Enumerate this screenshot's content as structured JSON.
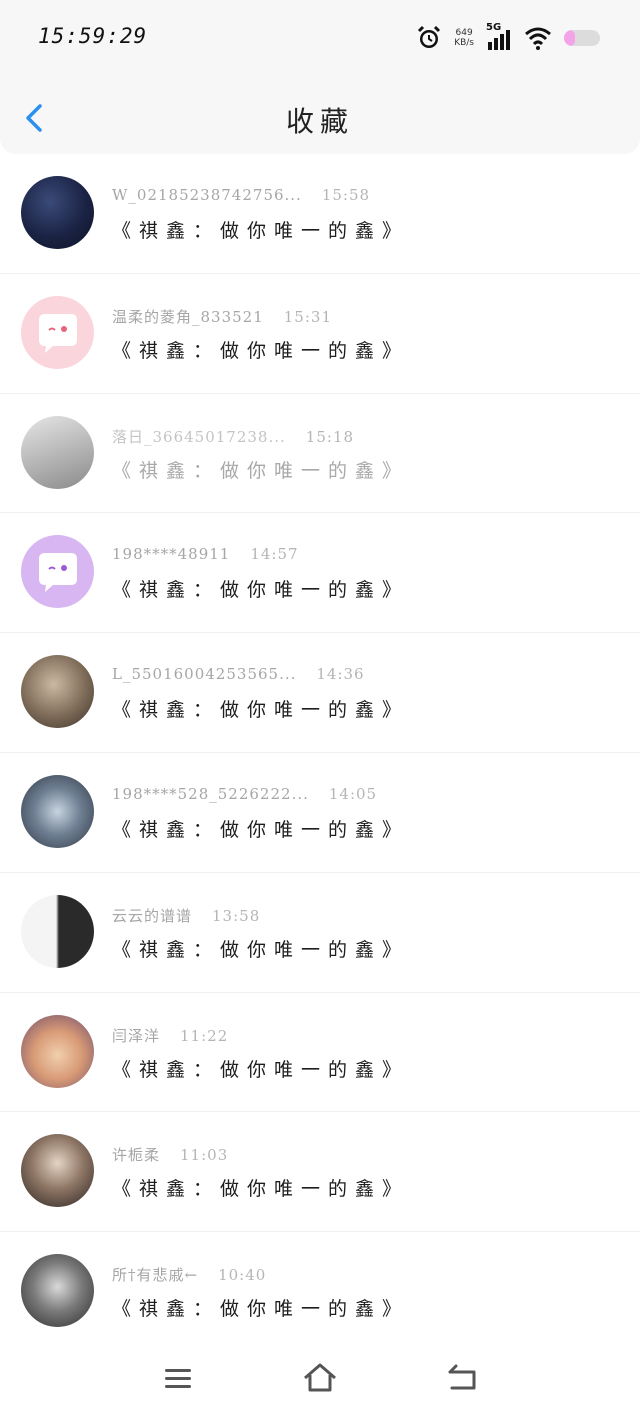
{
  "status": {
    "time": "15:59:29",
    "speed_value": "649",
    "speed_unit": "KB/s",
    "network": "5G",
    "battery_level": 0.3
  },
  "header": {
    "title": "收藏"
  },
  "items": [
    {
      "name": "W_02185238742756...",
      "time": "15:58",
      "message": "《祺鑫：做你唯一的鑫》",
      "avatar": "dark-portrait",
      "faded": false
    },
    {
      "name": "温柔的菱角_833521",
      "time": "15:31",
      "message": "《祺鑫：做你唯一的鑫》",
      "avatar": "pink-chat",
      "faded": false
    },
    {
      "name": "落日_36645017238...",
      "time": "15:18",
      "message": "《祺鑫：做你唯一的鑫》",
      "avatar": "gray-silhouette",
      "faded": true
    },
    {
      "name": "198****48911",
      "time": "14:57",
      "message": "《祺鑫：做你唯一的鑫》",
      "avatar": "purple-chat",
      "faded": false
    },
    {
      "name": "L_55016004253565...",
      "time": "14:36",
      "message": "《祺鑫：做你唯一的鑫》",
      "avatar": "sepia-portrait",
      "faded": false
    },
    {
      "name": "198****528_5226222...",
      "time": "14:05",
      "message": "《祺鑫：做你唯一的鑫》",
      "avatar": "snow-flowers",
      "faded": false
    },
    {
      "name": "云云的谱谱",
      "time": "13:58",
      "message": "《祺鑫：做你唯一的鑫》",
      "avatar": "two-boys",
      "faded": false
    },
    {
      "name": "闫泽洋",
      "time": "11:22",
      "message": "《祺鑫：做你唯一的鑫》",
      "avatar": "child-face",
      "faded": false
    },
    {
      "name": "许栀柔",
      "time": "11:03",
      "message": "《祺鑫：做你唯一的鑫》",
      "avatar": "girl-selfie",
      "faded": false
    },
    {
      "name": "所†有悲戚←",
      "time": "10:40",
      "message": "《祺鑫：做你唯一的鑫》",
      "avatar": "masked-person",
      "faded": false
    }
  ],
  "icons": {
    "back": "chevron-left-icon",
    "menu": "menu-icon",
    "home": "home-icon",
    "return": "back-arrow-icon"
  },
  "colors": {
    "accent": "#2b8ff0",
    "battery": "#f3a4e8"
  }
}
